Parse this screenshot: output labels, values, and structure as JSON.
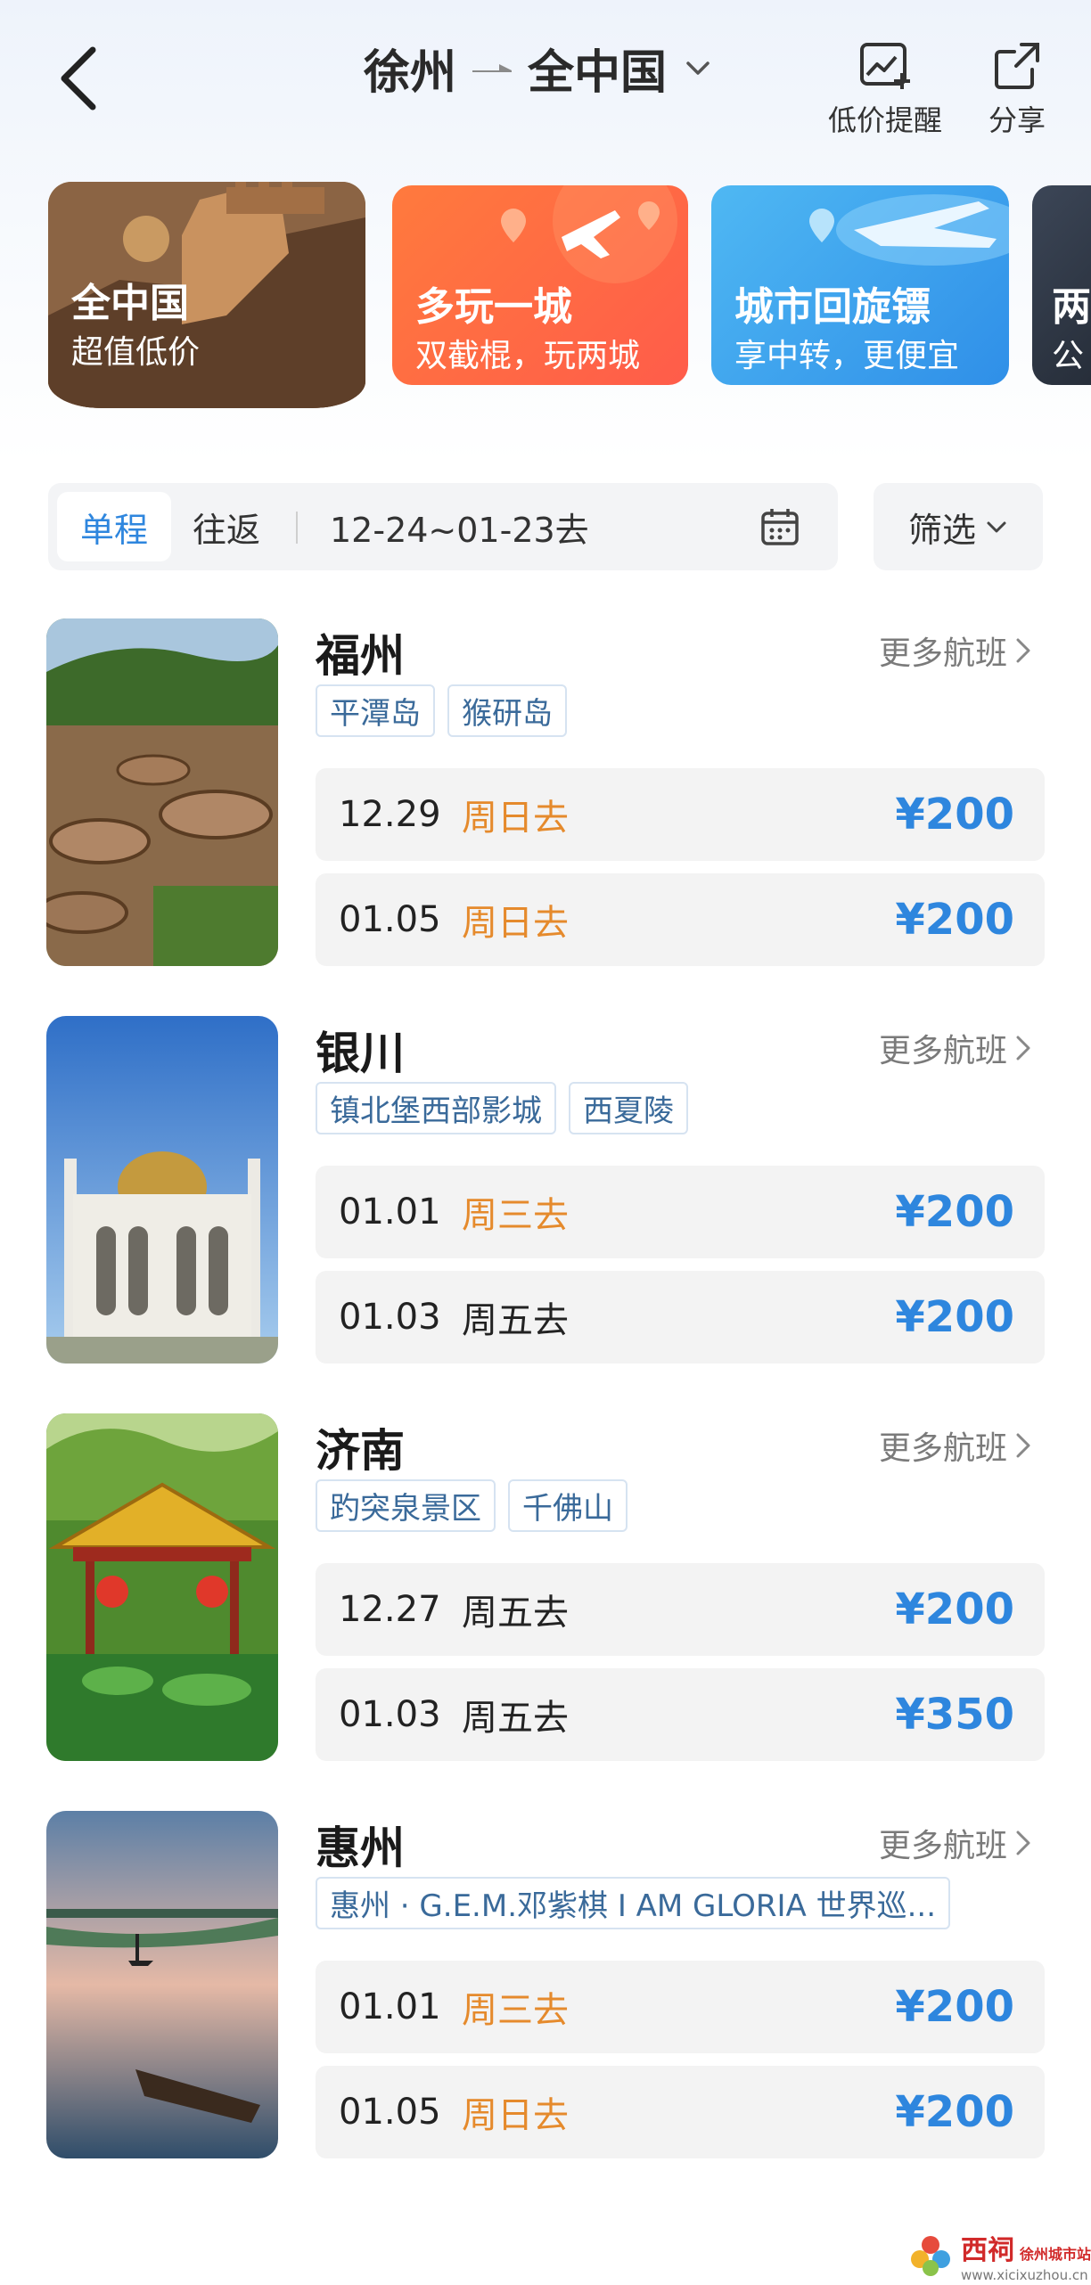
{
  "header": {
    "origin": "徐州",
    "destination": "全中国",
    "price_alert_label": "低价提醒",
    "share_label": "分享"
  },
  "banners": [
    {
      "title": "全中国",
      "subtitle": "超值低价"
    },
    {
      "title": "多玩一城",
      "subtitle": "双截棍，玩两城"
    },
    {
      "title": "城市回旋镖",
      "subtitle": "享中转，更便宜"
    },
    {
      "title": "两",
      "subtitle": "公"
    }
  ],
  "filters": {
    "one_way": "单程",
    "round_trip": "往返",
    "date_range": "12-24~01-23去",
    "filter_label": "筛选"
  },
  "more_flights_label": "更多航班",
  "destinations": [
    {
      "city": "福州",
      "tags": [
        "平潭岛",
        "猴研岛"
      ],
      "flights": [
        {
          "date": "12.29",
          "day": "周日去",
          "price": "¥200"
        },
        {
          "date": "01.05",
          "day": "周日去",
          "price": "¥200"
        }
      ]
    },
    {
      "city": "银川",
      "tags": [
        "镇北堡西部影城",
        "西夏陵"
      ],
      "flights": [
        {
          "date": "01.01",
          "day": "周三去",
          "price": "¥200"
        },
        {
          "date": "01.03",
          "day": "周五去",
          "price": "¥200"
        }
      ]
    },
    {
      "city": "济南",
      "tags": [
        "趵突泉景区",
        "千佛山"
      ],
      "flights": [
        {
          "date": "12.27",
          "day": "周五去",
          "price": "¥200"
        },
        {
          "date": "01.03",
          "day": "周五去",
          "price": "¥350"
        }
      ]
    },
    {
      "city": "惠州",
      "tags": [
        "惠州 · G.E.M.邓紫棋 I AM GLORIA 世界巡..."
      ],
      "flights": [
        {
          "date": "01.01",
          "day": "周三去",
          "price": "¥200"
        },
        {
          "date": "01.05",
          "day": "周日去",
          "price": "¥200"
        }
      ]
    }
  ],
  "watermark": {
    "name": "西祠",
    "sub": "徐州城市站",
    "url": "www.xicixuzhou.cn"
  },
  "colors": {
    "accent": "#2e86de",
    "weekend": "#e58a2c",
    "card_bg": "#f3f3f3"
  }
}
